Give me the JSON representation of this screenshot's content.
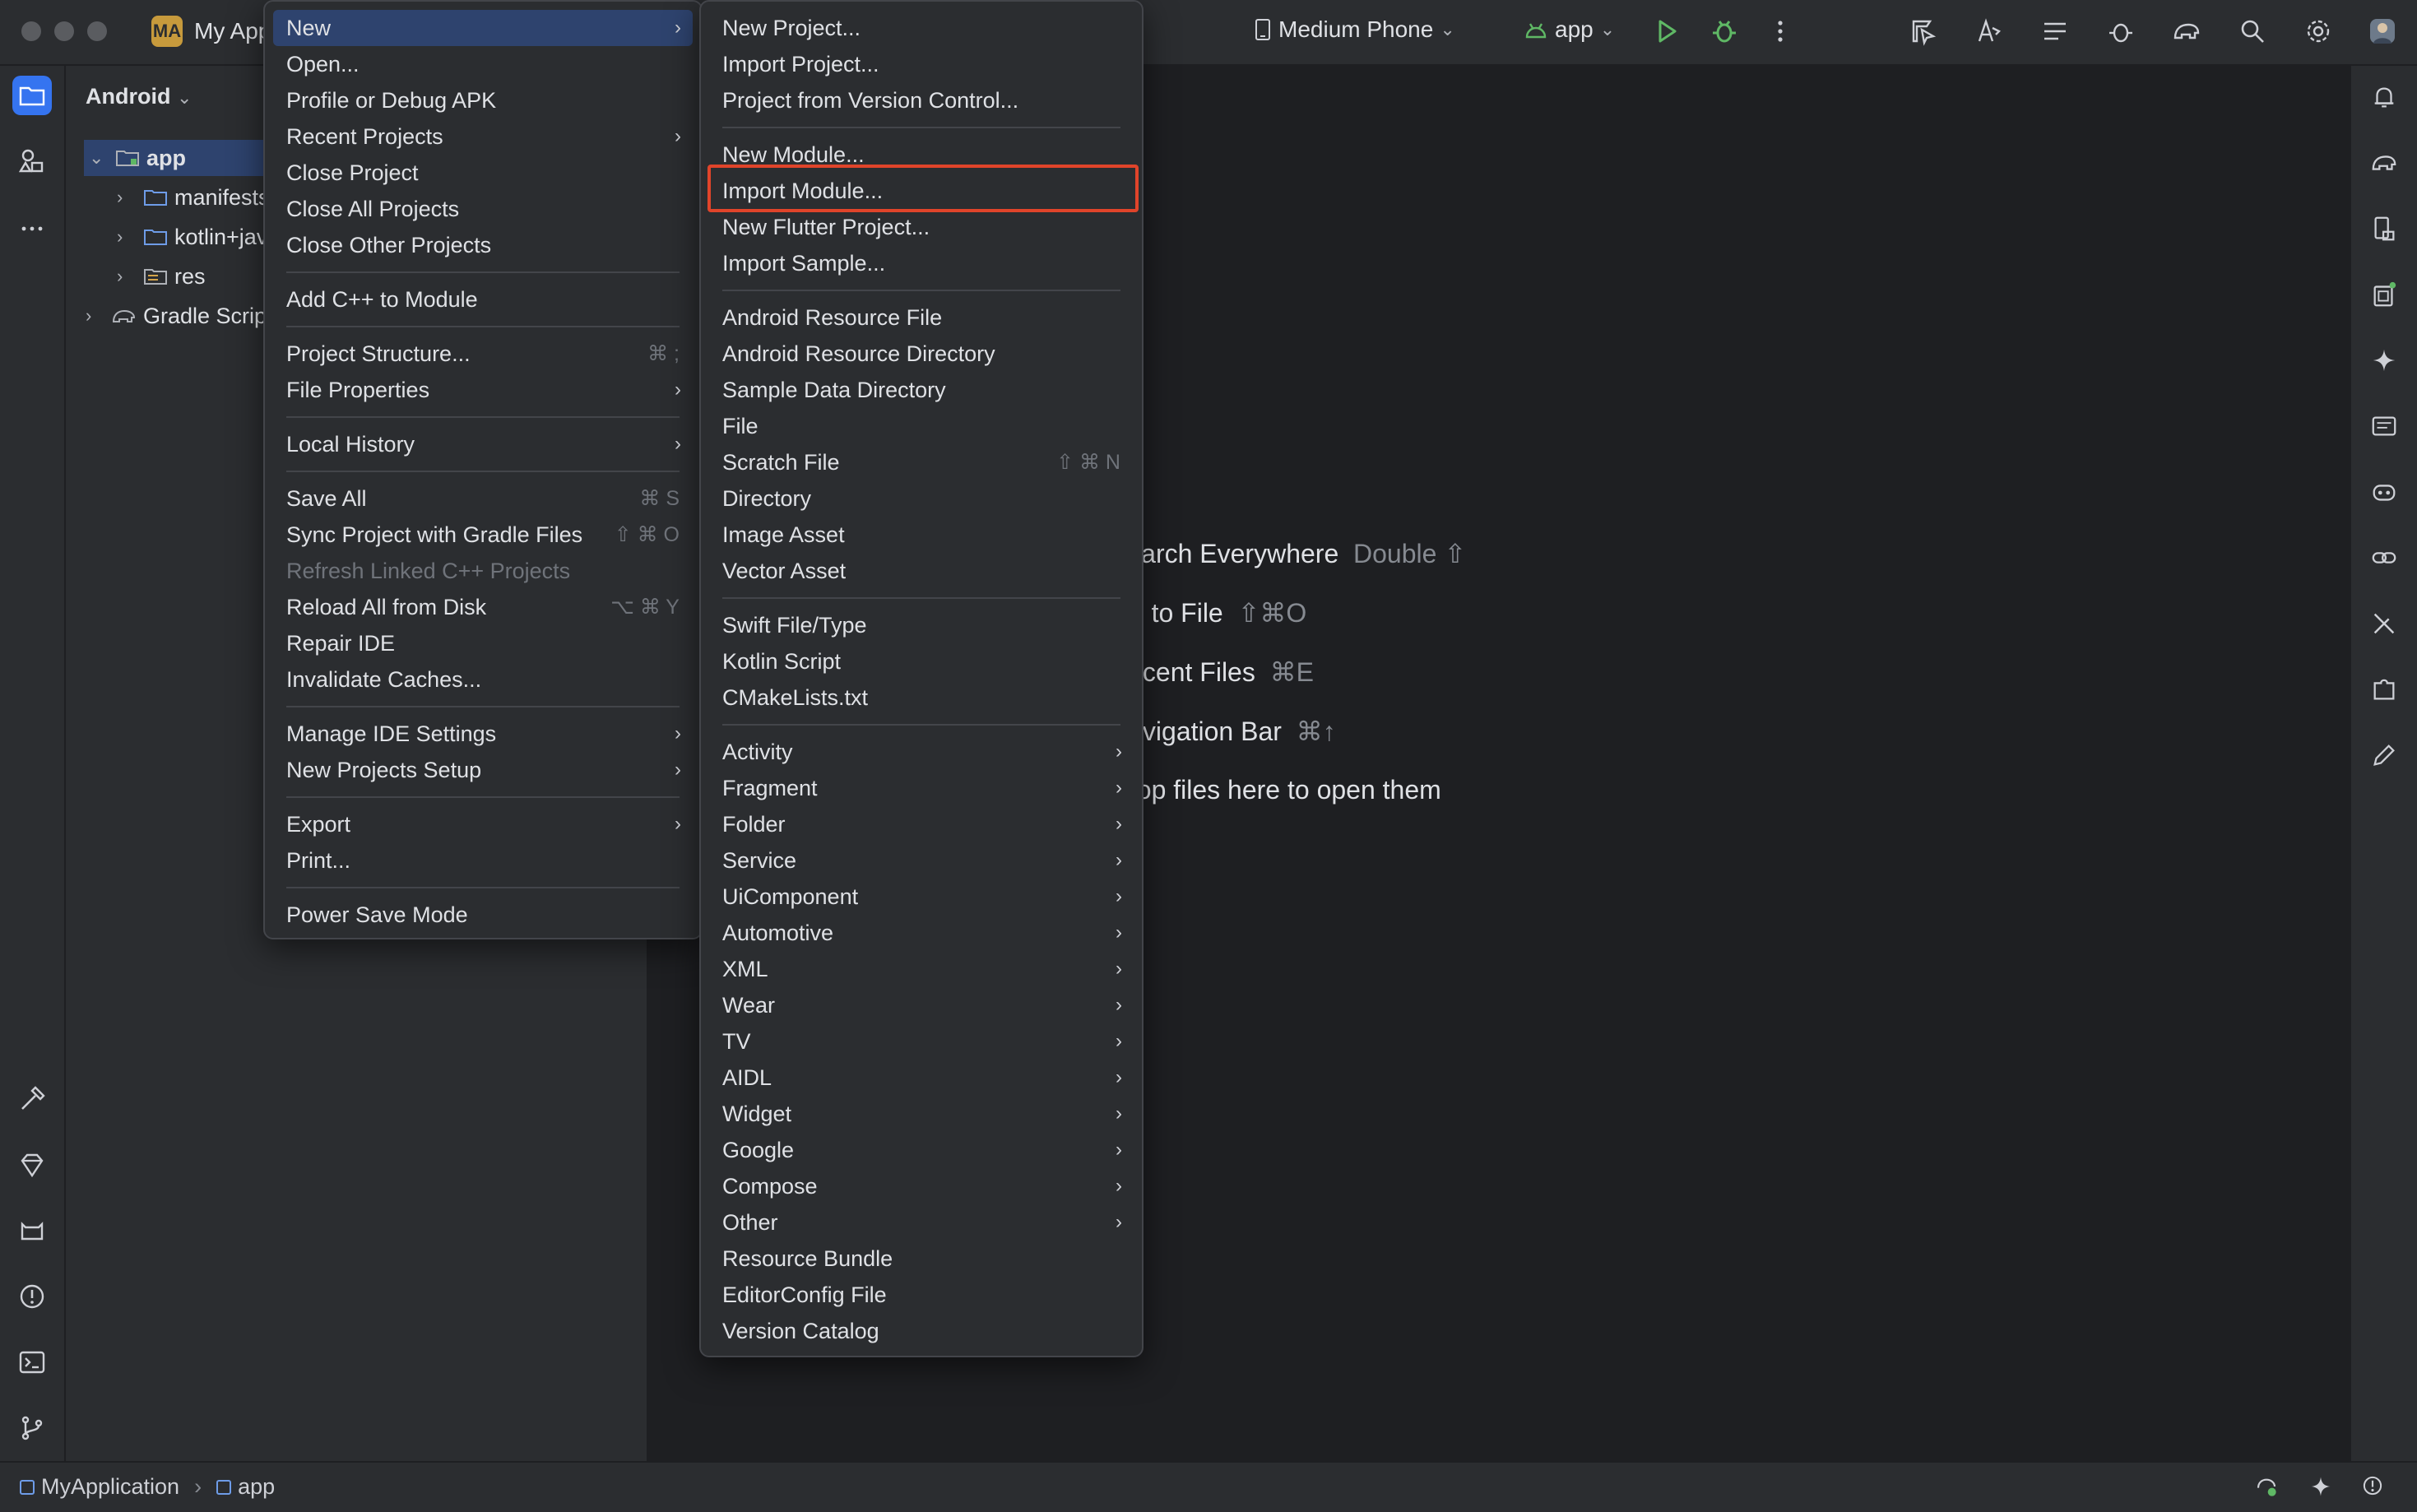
{
  "titlebar": {
    "project_badge": "MA",
    "project_name": "My Application",
    "device": "Medium Phone",
    "run_config": "app"
  },
  "project_panel": {
    "view_selector": "Android",
    "tree": [
      {
        "label": "app",
        "level": 0
      },
      {
        "label": "manifests",
        "level": 1
      },
      {
        "label": "kotlin+java",
        "level": 1
      },
      {
        "label": "res",
        "level": 1
      },
      {
        "label": "Gradle Scripts",
        "level": 0
      }
    ]
  },
  "editor_hints": [
    {
      "text": "Search Everywhere",
      "shortcut": "Double ⇧"
    },
    {
      "text": "Go to File",
      "shortcut": "⇧⌘O"
    },
    {
      "text": "Recent Files",
      "shortcut": "⌘E"
    },
    {
      "text": "Navigation Bar",
      "shortcut": "⌘↑"
    },
    {
      "text": "Drop files here to open them",
      "shortcut": ""
    }
  ],
  "file_menu": [
    {
      "label": "New",
      "submenu": true,
      "selected": true
    },
    {
      "label": "Open..."
    },
    {
      "label": "Profile or Debug APK"
    },
    {
      "label": "Recent Projects",
      "submenu": true
    },
    {
      "label": "Close Project"
    },
    {
      "label": "Close All Projects"
    },
    {
      "label": "Close Other Projects"
    },
    {
      "label": "Add C++ to Module"
    },
    {
      "label": "Project Structure...",
      "shortcut": "⌘ ;"
    },
    {
      "label": "File Properties",
      "submenu": true
    },
    {
      "label": "Local History",
      "submenu": true
    },
    {
      "label": "Save All",
      "shortcut": "⌘ S"
    },
    {
      "label": "Sync Project with Gradle Files",
      "shortcut": "⇧ ⌘ O"
    },
    {
      "label": "Refresh Linked C++ Projects",
      "disabled": true
    },
    {
      "label": "Reload All from Disk",
      "shortcut": "⌥ ⌘ Y"
    },
    {
      "label": "Repair IDE"
    },
    {
      "label": "Invalidate Caches..."
    },
    {
      "label": "Manage IDE Settings",
      "submenu": true
    },
    {
      "label": "New Projects Setup",
      "submenu": true
    },
    {
      "label": "Export",
      "submenu": true
    },
    {
      "label": "Print..."
    },
    {
      "label": "Power Save Mode"
    }
  ],
  "new_submenu": [
    {
      "label": "New Project..."
    },
    {
      "label": "Import Project..."
    },
    {
      "label": "Project from Version Control..."
    },
    {
      "label": "New Module..."
    },
    {
      "label": "Import Module...",
      "highlighted": true
    },
    {
      "label": "New Flutter Project..."
    },
    {
      "label": "Import Sample..."
    },
    {
      "label": "Android Resource File"
    },
    {
      "label": "Android Resource Directory"
    },
    {
      "label": "Sample Data Directory"
    },
    {
      "label": "File"
    },
    {
      "label": "Scratch File",
      "shortcut": "⇧ ⌘ N"
    },
    {
      "label": "Directory"
    },
    {
      "label": "Image Asset"
    },
    {
      "label": "Vector Asset"
    },
    {
      "label": "Swift File/Type"
    },
    {
      "label": "Kotlin Script"
    },
    {
      "label": "CMakeLists.txt"
    },
    {
      "label": "Activity",
      "submenu": true
    },
    {
      "label": "Fragment",
      "submenu": true
    },
    {
      "label": "Folder",
      "submenu": true
    },
    {
      "label": "Service",
      "submenu": true
    },
    {
      "label": "UiComponent",
      "submenu": true
    },
    {
      "label": "Automotive",
      "submenu": true
    },
    {
      "label": "XML",
      "submenu": true
    },
    {
      "label": "Wear",
      "submenu": true
    },
    {
      "label": "TV",
      "submenu": true
    },
    {
      "label": "AIDL",
      "submenu": true
    },
    {
      "label": "Widget",
      "submenu": true
    },
    {
      "label": "Google",
      "submenu": true
    },
    {
      "label": "Compose",
      "submenu": true
    },
    {
      "label": "Other",
      "submenu": true
    },
    {
      "label": "Resource Bundle"
    },
    {
      "label": "EditorConfig File"
    },
    {
      "label": "Version Catalog"
    }
  ],
  "statusbar": {
    "breadcrumb": [
      "MyApplication",
      "app"
    ]
  },
  "colors": {
    "accent": "#3574f0",
    "selection": "#2e436e",
    "highlight_box": "#e0442a",
    "run_green": "#5fb865"
  }
}
